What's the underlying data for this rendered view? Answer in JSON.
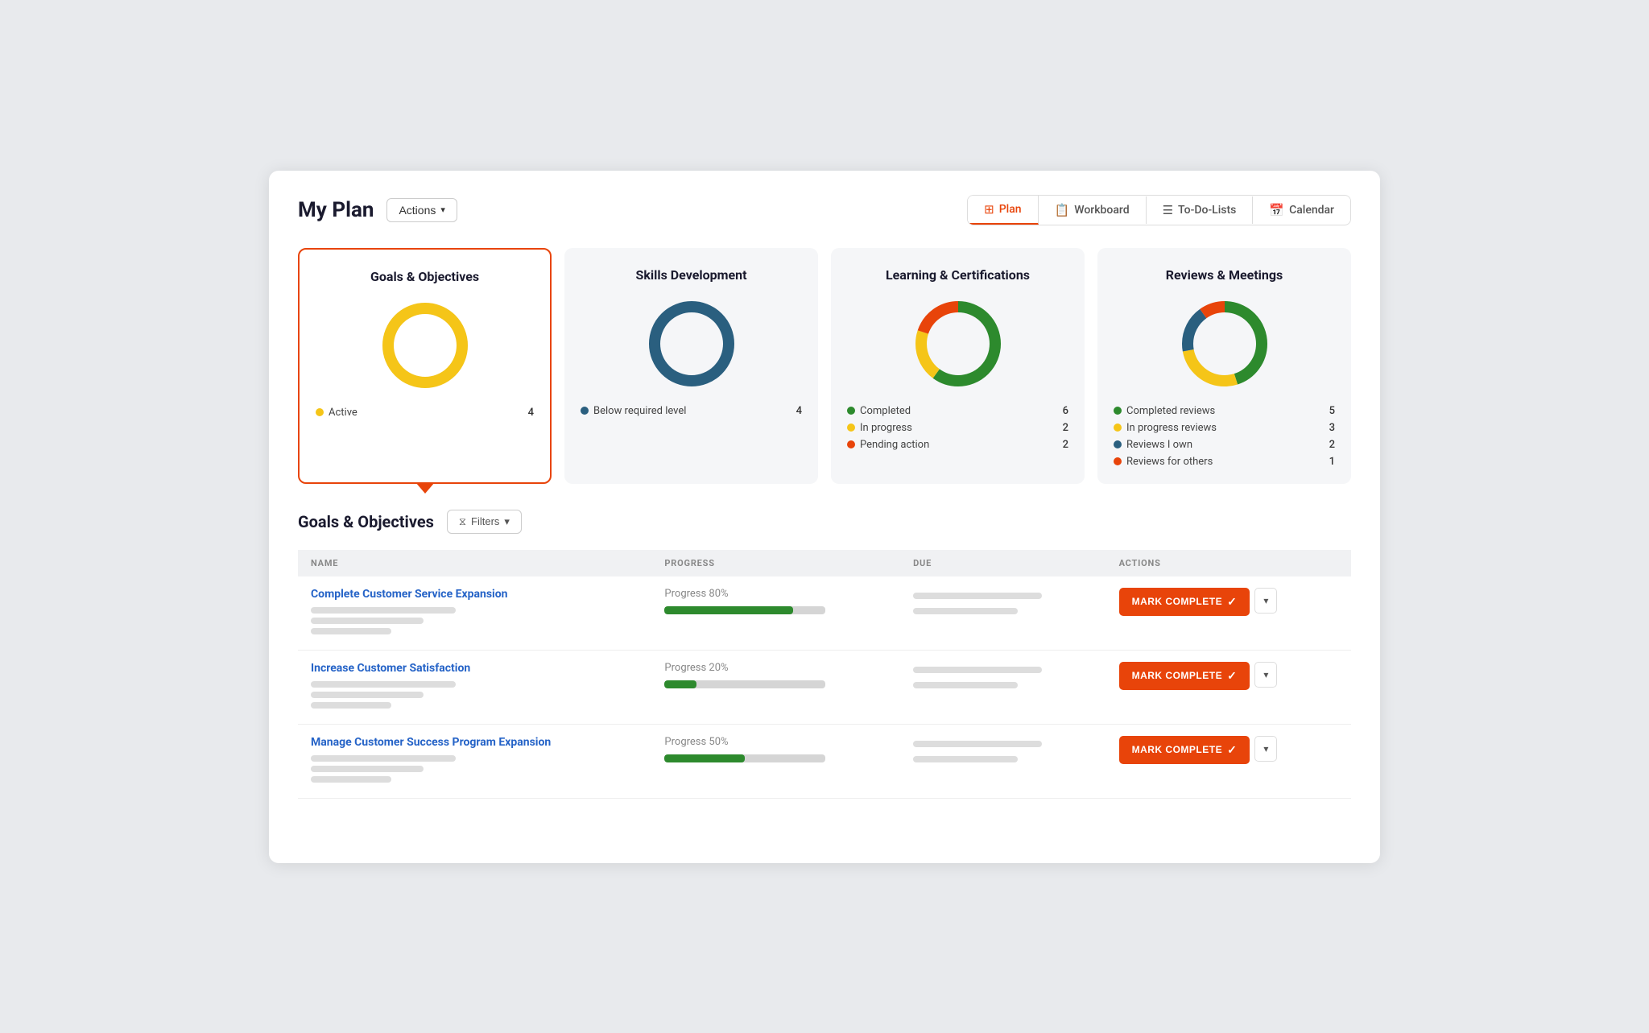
{
  "header": {
    "title": "My Plan",
    "actions_label": "Actions",
    "nav_tabs": [
      {
        "id": "plan",
        "label": "Plan",
        "icon": "⊞",
        "active": true
      },
      {
        "id": "workboard",
        "label": "Workboard",
        "icon": "📋",
        "active": false
      },
      {
        "id": "todo",
        "label": "To-Do-Lists",
        "icon": "☰",
        "active": false
      },
      {
        "id": "calendar",
        "label": "Calendar",
        "icon": "📅",
        "active": false
      }
    ]
  },
  "summary_cards": [
    {
      "id": "goals",
      "title": "Goals & Objectives",
      "active": true,
      "legend": [
        {
          "label": "Active",
          "color": "#f5c518",
          "count": "4"
        }
      ],
      "donut": {
        "segments": [
          {
            "color": "#f5c518",
            "value": 100
          }
        ]
      }
    },
    {
      "id": "skills",
      "title": "Skills Development",
      "active": false,
      "legend": [
        {
          "label": "Below required level",
          "color": "#2a5f7f",
          "count": "4"
        }
      ],
      "donut": {
        "segments": [
          {
            "color": "#2a5f7f",
            "value": 100
          }
        ]
      }
    },
    {
      "id": "learning",
      "title": "Learning & Certifications",
      "active": false,
      "legend": [
        {
          "label": "Completed",
          "color": "#2d8a2d",
          "count": "6"
        },
        {
          "label": "In progress",
          "color": "#f5c518",
          "count": "2"
        },
        {
          "label": "Pending action",
          "color": "#e8440a",
          "count": "2"
        }
      ],
      "donut": {
        "segments": [
          {
            "color": "#2d8a2d",
            "pct": 60
          },
          {
            "color": "#f5c518",
            "pct": 20
          },
          {
            "color": "#e8440a",
            "pct": 20
          }
        ]
      }
    },
    {
      "id": "reviews",
      "title": "Reviews & Meetings",
      "active": false,
      "legend": [
        {
          "label": "Completed reviews",
          "color": "#2d8a2d",
          "count": "5"
        },
        {
          "label": "In progress reviews",
          "color": "#f5c518",
          "count": "3"
        },
        {
          "label": "Reviews I own",
          "color": "#2a5f7f",
          "count": "2"
        },
        {
          "label": "Reviews for others",
          "color": "#e8440a",
          "count": "1"
        }
      ],
      "donut": {
        "segments": [
          {
            "color": "#2d8a2d",
            "pct": 45
          },
          {
            "color": "#f5c518",
            "pct": 27
          },
          {
            "color": "#2a5f7f",
            "pct": 18
          },
          {
            "color": "#e8440a",
            "pct": 10
          }
        ]
      }
    }
  ],
  "goals_section": {
    "title": "Goals & Objectives",
    "filters_label": "Filters",
    "table_headers": [
      "NAME",
      "PROGRESS",
      "DUE",
      "ACTIONS"
    ],
    "rows": [
      {
        "id": "row1",
        "name": "Complete Customer Service Expansion",
        "progress_label": "Progress 80%",
        "progress_pct": 80,
        "mark_complete_label": "MARK COMPLETE"
      },
      {
        "id": "row2",
        "name": "Increase Customer Satisfaction",
        "progress_label": "Progress 20%",
        "progress_pct": 20,
        "mark_complete_label": "MARK COMPLETE"
      },
      {
        "id": "row3",
        "name": "Manage Customer Success Program Expansion",
        "progress_label": "Progress 50%",
        "progress_pct": 50,
        "mark_complete_label": "MARK COMPLETE"
      }
    ]
  },
  "colors": {
    "orange": "#e8440a",
    "blue": "#2563c7",
    "green": "#2d8a2d",
    "yellow": "#f5c518",
    "dark_blue": "#2a5f7f"
  }
}
